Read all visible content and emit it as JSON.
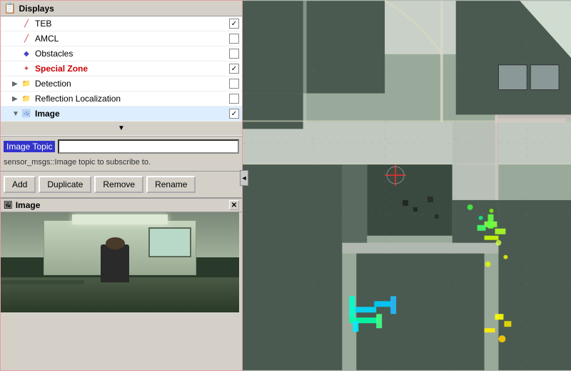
{
  "displays": {
    "header_label": "Displays",
    "items": [
      {
        "name": "TEB",
        "indent": 1,
        "checked": true,
        "icon": "slash",
        "color": "#cc3333"
      },
      {
        "name": "AMCL",
        "indent": 1,
        "checked": false,
        "icon": "slash",
        "color": "#cc3333"
      },
      {
        "name": "Obstacles",
        "indent": 1,
        "checked": false,
        "icon": "diamond",
        "color": "#4444cc"
      },
      {
        "name": "Special Zone",
        "indent": 1,
        "checked": true,
        "icon": "star",
        "color": "#cc4444"
      },
      {
        "name": "Detection",
        "indent": 1,
        "checked": false,
        "icon": "folder",
        "color": "#8888aa",
        "expandable": true
      },
      {
        "name": "Reflection Localization",
        "indent": 1,
        "checked": false,
        "icon": "folder",
        "color": "#8888aa",
        "expandable": true
      },
      {
        "name": "Image",
        "indent": 1,
        "checked": true,
        "icon": "image",
        "color": "#4477cc"
      }
    ]
  },
  "properties": {
    "image_topic_label": "Image Topic",
    "image_topic_value": "",
    "description": "sensor_msgs::Image topic to subscribe to."
  },
  "buttons": {
    "add": "Add",
    "duplicate": "Duplicate",
    "remove": "Remove",
    "rename": "Rename"
  },
  "image_window": {
    "title": "Image"
  },
  "icons": {
    "close": "✕",
    "expand": "▶",
    "collapse": "▼",
    "check": "✓",
    "arrow_down": "▼",
    "arrow_left": "◄"
  }
}
